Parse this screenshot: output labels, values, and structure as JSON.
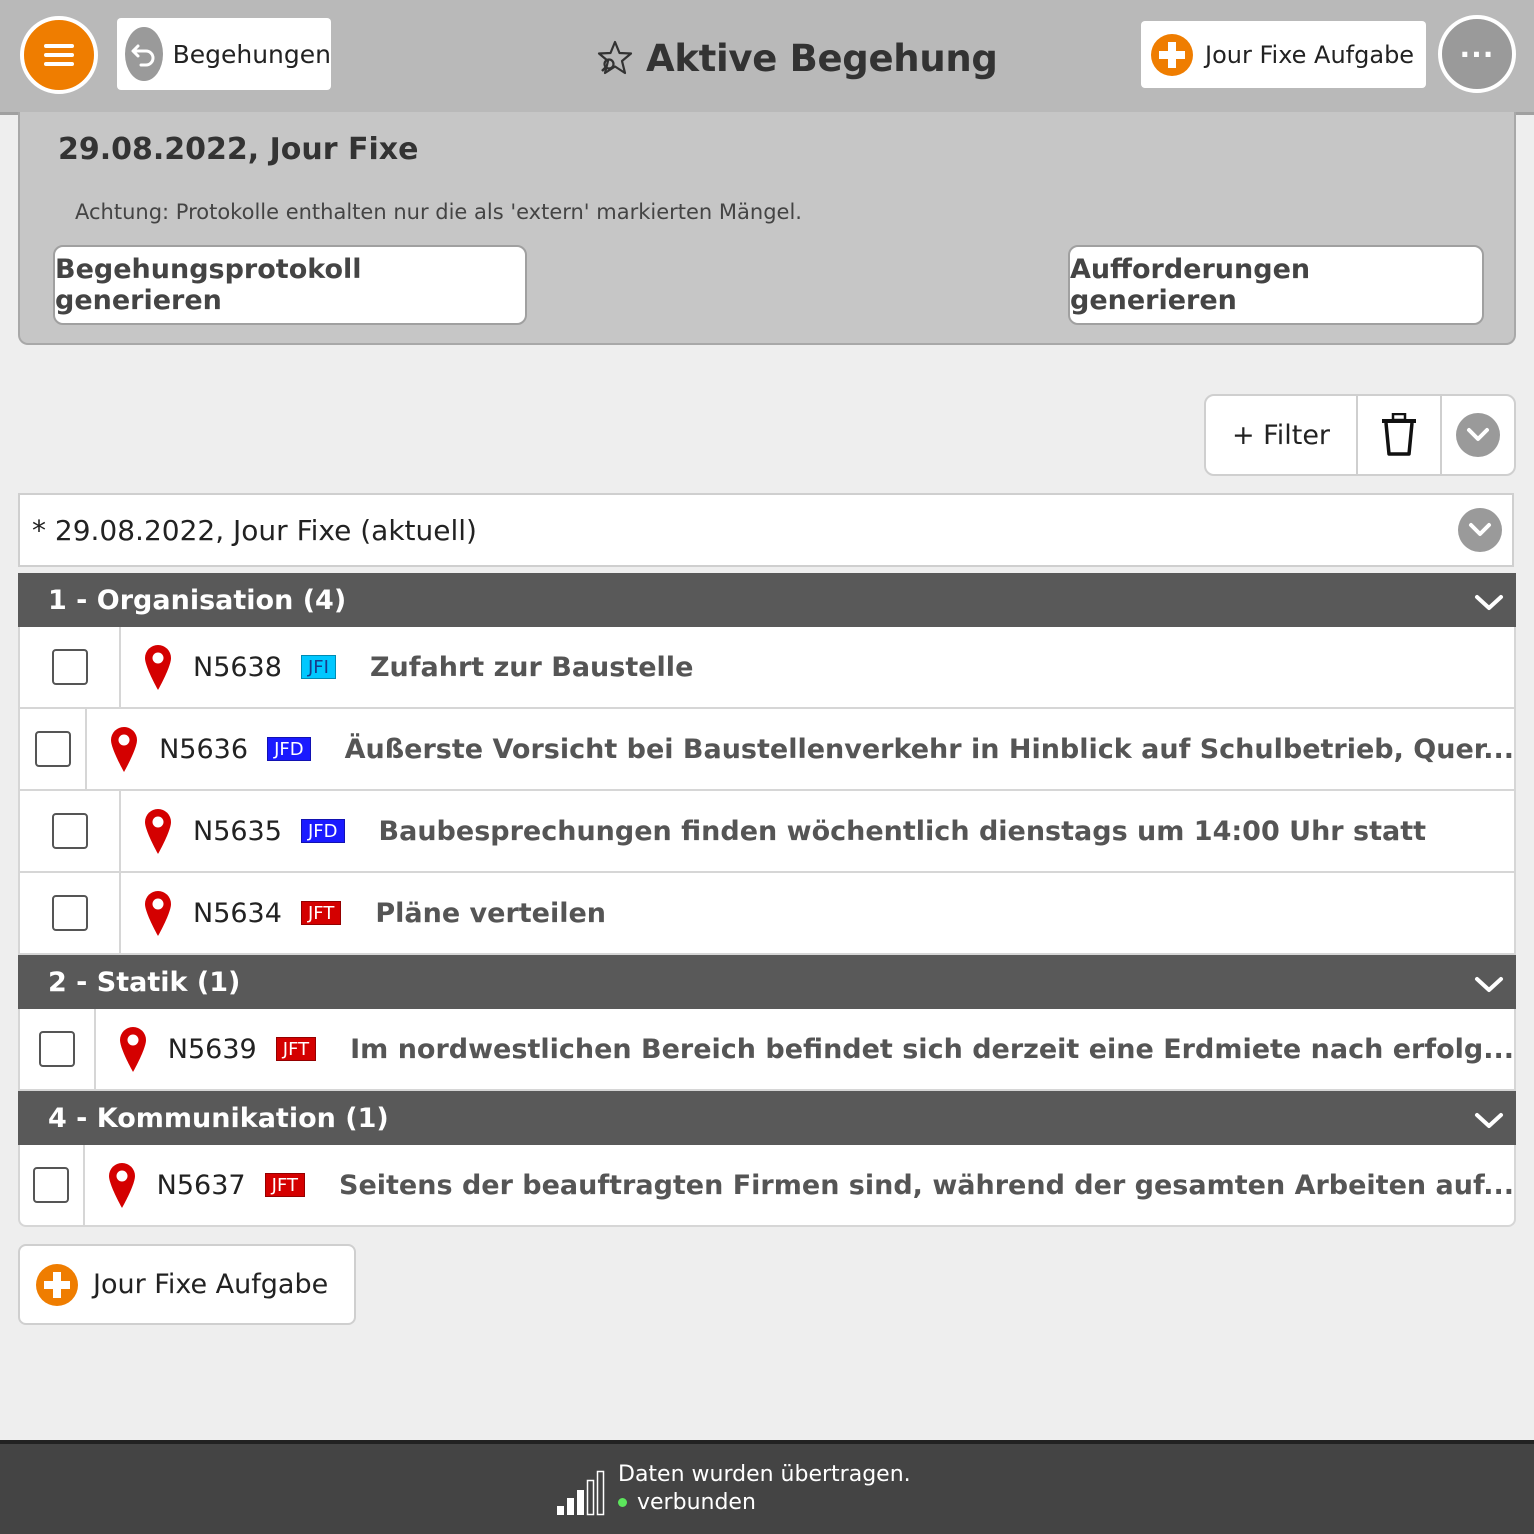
{
  "header": {
    "back_label": "Begehungen",
    "title": "Aktive Begehung",
    "add_task_label": "Jour Fixe Aufgabe",
    "more_label": "···"
  },
  "panel": {
    "title": "29.08.2022, Jour Fixe",
    "note": "Achtung: Protokolle enthalten nur die als 'extern' markierten Mängel.",
    "protocol_button": "Begehungsprotokoll generieren",
    "requests_button": "Aufforderungen generieren"
  },
  "filter": {
    "filter_label": "+ Filter"
  },
  "session_select": {
    "selected": "* 29.08.2022, Jour Fixe (aktuell)"
  },
  "groups": [
    {
      "label": "1 - Organisation (4)",
      "items": [
        {
          "id": "N5638",
          "tag": "JFI",
          "tag_color": "#00c8ff",
          "tag_text_color": "#1a3a8a",
          "text": "Zufahrt zur Baustelle"
        },
        {
          "id": "N5636",
          "tag": "JFD",
          "tag_color": "#1a1aff",
          "tag_text_color": "#ffffff",
          "text": "Äußerste Vorsicht bei Baustellenverkehr in Hinblick auf Schulbetrieb, Quer..."
        },
        {
          "id": "N5635",
          "tag": "JFD",
          "tag_color": "#1a1aff",
          "tag_text_color": "#ffffff",
          "text": "Baubesprechungen finden wöchentlich dienstags um 14:00 Uhr statt"
        },
        {
          "id": "N5634",
          "tag": "JFT",
          "tag_color": "#d40000",
          "tag_text_color": "#ffffff",
          "text": "Pläne verteilen"
        }
      ]
    },
    {
      "label": "2 - Statik (1)",
      "items": [
        {
          "id": "N5639",
          "tag": "JFT",
          "tag_color": "#d40000",
          "tag_text_color": "#ffffff",
          "text": "Im nordwestlichen Bereich befindet sich derzeit eine Erdmiete nach erfolg..."
        }
      ]
    },
    {
      "label": "4 - Kommunikation (1)",
      "items": [
        {
          "id": "N5637",
          "tag": "JFT",
          "tag_color": "#d40000",
          "tag_text_color": "#ffffff",
          "text": "Seitens der beauftragten Firmen sind, während der gesamten Arbeiten auf..."
        }
      ]
    }
  ],
  "footer_add_label": "Jour Fixe Aufgabe",
  "status": {
    "line1": "Daten wurden übertragen.",
    "line2": "verbunden",
    "connected_color": "#5ce65c"
  },
  "colors": {
    "accent": "#ef7d00",
    "group_header": "#595959",
    "pin": "#d40000"
  }
}
